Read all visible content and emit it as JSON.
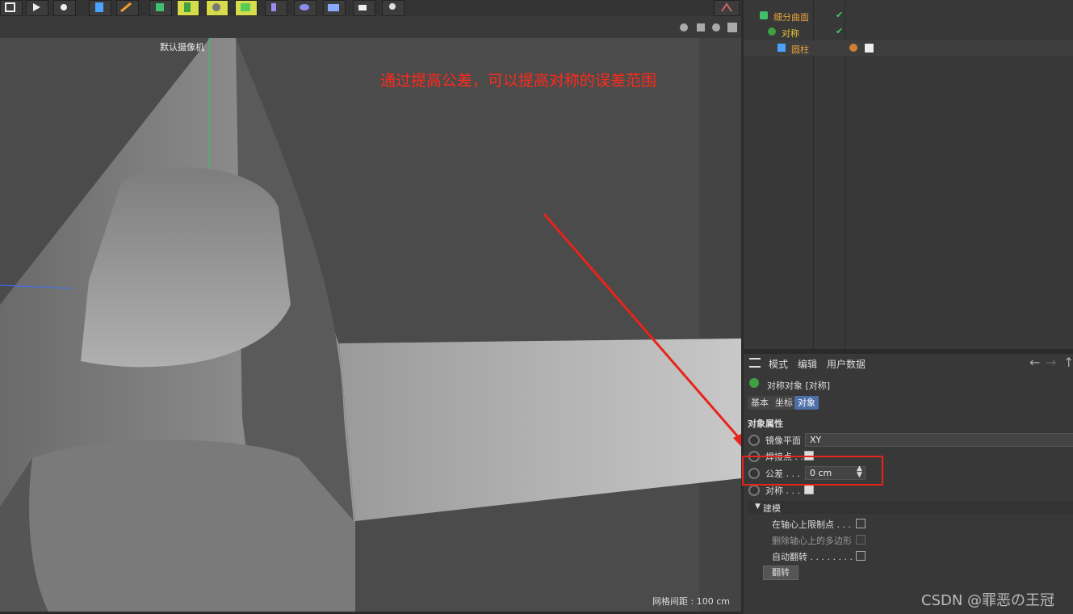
{
  "viewport": {
    "camera_label": "默认摄像机",
    "annotation": "通过提高公差，可以提高对称的误差范围",
    "grid_spacing": "网格间距 : 100 cm"
  },
  "object_manager": {
    "objects": [
      {
        "name": "细分曲面",
        "color": "#e8a23a"
      },
      {
        "name": "对称",
        "color": "#e8c23a"
      },
      {
        "name": "圆柱",
        "color": "#e8a23a"
      }
    ]
  },
  "attributes": {
    "menu": [
      "模式",
      "编辑",
      "用户数据"
    ],
    "object_title": "对称对象 [对称]",
    "tabs": [
      "基本",
      "坐标",
      "对象"
    ],
    "active_tab": "对象",
    "section": "对象属性",
    "mirror_plane_label": "镜像平面",
    "mirror_plane_value": "XY",
    "weld_label": "焊接点 . .",
    "tolerance_label": "公差 . . .",
    "tolerance_value": "0 cm",
    "symmetry_label": "对称 . . .",
    "modeling_section": "建模",
    "clamp_label": "在轴心上限制点 . . .",
    "delete_label": "删除轴心上的多边形",
    "autoflip_label": "自动翻转 . . . . . . . .",
    "flip_button": "翻转"
  },
  "watermark": "CSDN @罪恶の王冠",
  "colors": {
    "annotation": "#ff2a1a",
    "highlight_box": "#e8231a",
    "active_tab": "#4d6fa8"
  }
}
